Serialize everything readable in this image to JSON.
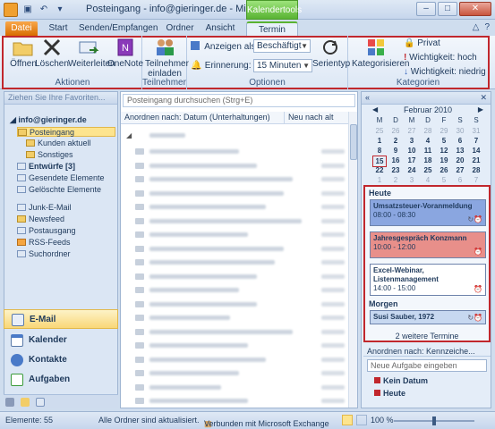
{
  "window": {
    "title": "Posteingang - info@gieringer.de - Microsoft O...",
    "context_tab_title": "Kalendertools"
  },
  "tabs": [
    {
      "label": "Datei"
    },
    {
      "label": "Start"
    },
    {
      "label": "Senden/Empfangen"
    },
    {
      "label": "Ordner"
    },
    {
      "label": "Ansicht"
    },
    {
      "label": "Termin"
    }
  ],
  "ribbon": {
    "groups": {
      "aktionen": "Aktionen",
      "teilnehmer": "Teilnehmer",
      "optionen": "Optionen",
      "kategorien": "Kategorien"
    },
    "buttons": {
      "oeffnen": "Öffnen",
      "loeschen": "Löschen",
      "weiterleiten": "Weiterleiten",
      "onenote": "OneNote",
      "teilnehmer_einladen_1": "Teilnehmer",
      "teilnehmer_einladen_2": "einladen",
      "serientyp": "Serientyp",
      "kategorisieren": "Kategorisieren",
      "privat": "Privat",
      "wichtig_hoch": "Wichtigkeit: hoch",
      "wichtig_niedrig": "Wichtigkeit: niedrig"
    },
    "anzeigen_als_label": "Anzeigen als:",
    "anzeigen_als_value": "Beschäftigt",
    "erinnerung_label": "Erinnerung:",
    "erinnerung_value": "15 Minuten"
  },
  "nav": {
    "favorites_header": "Ziehen Sie Ihre Favoriten...",
    "account": "info@gieringer.de",
    "folders": [
      {
        "label": "Posteingang"
      },
      {
        "label": "Kunden aktuell"
      },
      {
        "label": "Sonstiges"
      },
      {
        "label": "Entwürfe [3]"
      },
      {
        "label": "Gesendete Elemente"
      },
      {
        "label": "Gelöschte Elemente"
      },
      {
        "label": "Junk-E-Mail"
      },
      {
        "label": "Newsfeed"
      },
      {
        "label": "Postausgang"
      },
      {
        "label": "RSS-Feeds"
      },
      {
        "label": "Suchordner"
      }
    ],
    "buttons": [
      {
        "label": "E-Mail"
      },
      {
        "label": "Kalender"
      },
      {
        "label": "Kontakte"
      },
      {
        "label": "Aufgaben"
      }
    ]
  },
  "maillist": {
    "search_placeholder": "Posteingang durchsuchen (Strg+E)",
    "sort_label": "Anordnen nach: Datum (Unterhaltungen)",
    "sort_order": "Neu nach alt"
  },
  "todo": {
    "month": "Februar 2010",
    "weekdays": [
      "M",
      "D",
      "M",
      "D",
      "F",
      "S",
      "S"
    ],
    "weeks": [
      [
        "25",
        "26",
        "27",
        "28",
        "29",
        "30",
        "31"
      ],
      [
        "1",
        "2",
        "3",
        "4",
        "5",
        "6",
        "7"
      ],
      [
        "8",
        "9",
        "10",
        "11",
        "12",
        "13",
        "14"
      ],
      [
        "15",
        "16",
        "17",
        "18",
        "19",
        "20",
        "21"
      ],
      [
        "22",
        "23",
        "24",
        "25",
        "26",
        "27",
        "28"
      ],
      [
        "1",
        "2",
        "3",
        "4",
        "5",
        "6",
        "7"
      ]
    ],
    "today_label": "Heute",
    "tomorrow_label": "Morgen",
    "appointments": [
      {
        "title": "Umsatzsteuer-Voranmeldung",
        "time": "08:00 - 08:30",
        "color": "#8aa6e0"
      },
      {
        "title": "Jahresgespräch Konzmann",
        "time": "10:00 - 12:00",
        "color": "#e88f8a"
      },
      {
        "title": "Excel-Webinar, Listenmanagement",
        "time": "14:00 - 15:00",
        "color": "#ffffff"
      }
    ],
    "tomorrow": {
      "title": "Susi Sauber, 1972"
    },
    "more": "2 weitere Termine",
    "task_sort": "Anordnen nach: Kennzeiche...",
    "new_task_placeholder": "Neue Aufgabe eingeben",
    "task_groups": [
      "Kein Datum",
      "Heute"
    ]
  },
  "status": {
    "items": "Elemente: 55",
    "sync": "Alle Ordner sind aktualisiert.",
    "exchange": "Verbunden mit Microsoft Exchange",
    "zoom": "100 %"
  }
}
